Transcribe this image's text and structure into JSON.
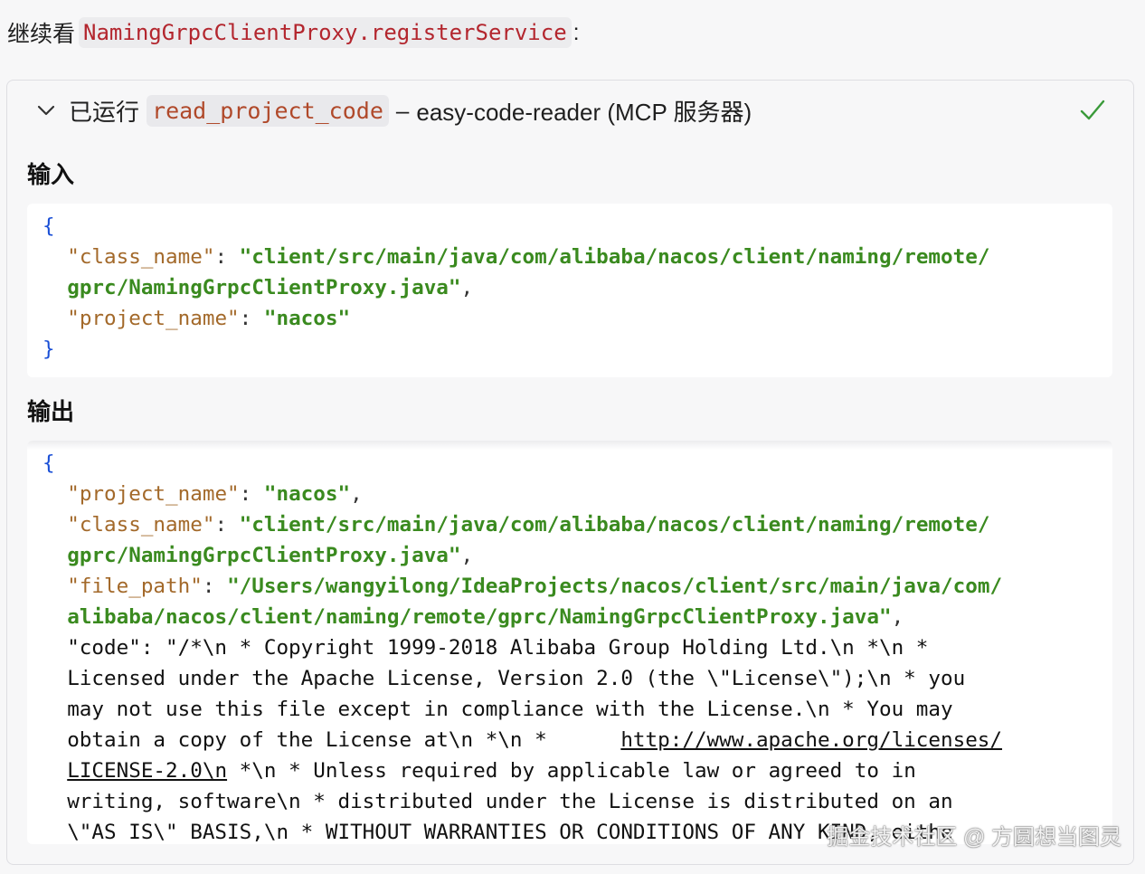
{
  "intro": {
    "prefix": "继续看",
    "code": "NamingGrpcClientProxy.registerService",
    "suffix": ":"
  },
  "tool_call": {
    "status_label": "已运行",
    "tool_name": "read_project_code",
    "separator": "–",
    "server_label": "easy-code-reader (MCP 服务器)",
    "status_icon": "checkmark-icon",
    "collapse_icon": "chevron-down-icon"
  },
  "input": {
    "title": "输入",
    "lines": [
      {
        "parts": [
          {
            "t": "{",
            "c": "brace"
          }
        ]
      },
      {
        "parts": [
          {
            "t": "  ",
            "c": "plain"
          },
          {
            "t": "\"class_name\"",
            "c": "key"
          },
          {
            "t": ": ",
            "c": "punc"
          },
          {
            "t": "\"client/src/main/java/com/alibaba/nacos/client/naming/remote/",
            "c": "str"
          }
        ]
      },
      {
        "parts": [
          {
            "t": "  ",
            "c": "plain"
          },
          {
            "t": "gprc/NamingGrpcClientProxy.java\"",
            "c": "str"
          },
          {
            "t": ",",
            "c": "punc"
          }
        ]
      },
      {
        "parts": [
          {
            "t": "  ",
            "c": "plain"
          },
          {
            "t": "\"project_name\"",
            "c": "key"
          },
          {
            "t": ": ",
            "c": "punc"
          },
          {
            "t": "\"nacos\"",
            "c": "str"
          }
        ]
      },
      {
        "parts": [
          {
            "t": "}",
            "c": "brace"
          }
        ]
      }
    ]
  },
  "output": {
    "title": "输出",
    "lines": [
      {
        "parts": [
          {
            "t": "{",
            "c": "brace"
          }
        ]
      },
      {
        "parts": [
          {
            "t": "  ",
            "c": "plain"
          },
          {
            "t": "\"project_name\"",
            "c": "key"
          },
          {
            "t": ": ",
            "c": "punc"
          },
          {
            "t": "\"nacos\"",
            "c": "str"
          },
          {
            "t": ",",
            "c": "punc"
          }
        ]
      },
      {
        "parts": [
          {
            "t": "  ",
            "c": "plain"
          },
          {
            "t": "\"class_name\"",
            "c": "key"
          },
          {
            "t": ": ",
            "c": "punc"
          },
          {
            "t": "\"client/src/main/java/com/alibaba/nacos/client/naming/remote/",
            "c": "str"
          }
        ]
      },
      {
        "parts": [
          {
            "t": "  ",
            "c": "plain"
          },
          {
            "t": "gprc/NamingGrpcClientProxy.java\"",
            "c": "str"
          },
          {
            "t": ",",
            "c": "punc"
          }
        ]
      },
      {
        "parts": [
          {
            "t": "  ",
            "c": "plain"
          },
          {
            "t": "\"file_path\"",
            "c": "key"
          },
          {
            "t": ": ",
            "c": "punc"
          },
          {
            "t": "\"/Users/wangyilong/IdeaProjects/nacos/client/src/main/java/com/",
            "c": "str"
          }
        ]
      },
      {
        "parts": [
          {
            "t": "  ",
            "c": "plain"
          },
          {
            "t": "alibaba/nacos/client/naming/remote/gprc/NamingGrpcClientProxy.java\"",
            "c": "str"
          },
          {
            "t": ",",
            "c": "punc"
          }
        ]
      },
      {
        "parts": [
          {
            "t": "  \"code\": \"/*\\n * Copyright 1999-2018 Alibaba Group Holding Ltd.\\n *\\n *",
            "c": "plain"
          }
        ]
      },
      {
        "parts": [
          {
            "t": "  Licensed under the Apache License, Version 2.0 (the \\\"License\\\");\\n * you",
            "c": "plain"
          }
        ]
      },
      {
        "parts": [
          {
            "t": "  may not use this file except in compliance with the License.\\n * You may",
            "c": "plain"
          }
        ]
      },
      {
        "parts": [
          {
            "t": "  obtain a copy of the License at\\n *\\n *      ",
            "c": "plain"
          },
          {
            "t": "http://www.apache.org/licenses/",
            "c": "link"
          }
        ]
      },
      {
        "parts": [
          {
            "t": "  ",
            "c": "plain"
          },
          {
            "t": "LICENSE-2.0\\n",
            "c": "link"
          },
          {
            "t": " *\\n * Unless required by applicable law or agreed to in",
            "c": "plain"
          }
        ]
      },
      {
        "parts": [
          {
            "t": "  writing, software\\n * distributed under the License is distributed on an",
            "c": "plain"
          }
        ]
      },
      {
        "parts": [
          {
            "t": "  \\\"AS IS\\\" BASIS,\\n * WITHOUT WARRANTIES OR CONDITIONS OF ANY KIND, eithe",
            "c": "plain"
          }
        ]
      }
    ]
  },
  "watermark": "掘金技术社区 @ 方圆想当图灵"
}
